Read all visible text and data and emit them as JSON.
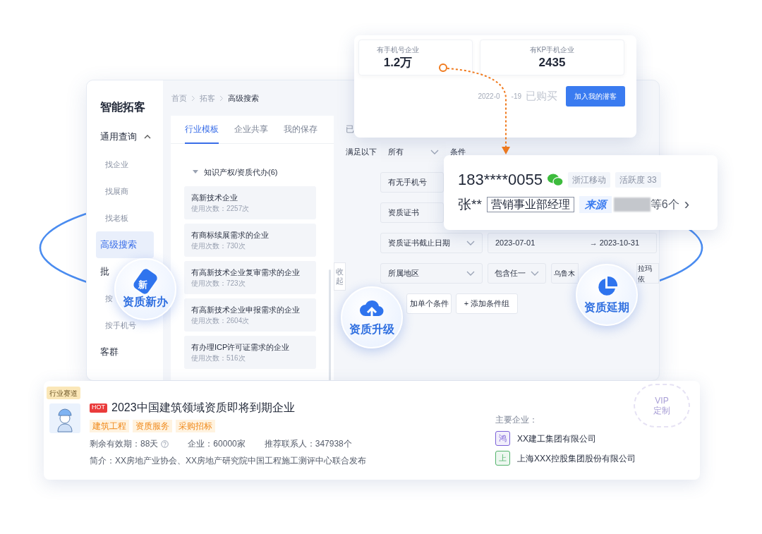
{
  "sidebar": {
    "title": "智能拓客",
    "items": [
      {
        "label": "通用查询",
        "kind": "group",
        "expanded": true
      },
      {
        "label": "找企业",
        "kind": "sub",
        "selected": false
      },
      {
        "label": "找展商",
        "kind": "sub",
        "selected": false
      },
      {
        "label": "找老板",
        "kind": "sub",
        "selected": false
      },
      {
        "label": "高级搜索",
        "kind": "main",
        "selected": true
      },
      {
        "label": "批",
        "kind": "main",
        "selected": false
      },
      {
        "label": "按",
        "kind": "sub",
        "selected": false
      },
      {
        "label": "按手机号",
        "kind": "sub",
        "selected": false
      },
      {
        "label": "客群",
        "kind": "main",
        "selected": false
      }
    ]
  },
  "breadcrumb": [
    "首页",
    "拓客",
    "高级搜索"
  ],
  "template_tabs": [
    {
      "label": "行业模板",
      "selected": true
    },
    {
      "label": "企业共享",
      "selected": false
    },
    {
      "label": "我的保存",
      "selected": false
    }
  ],
  "template_group": {
    "label": "知识产权/资质代办(6)",
    "expanded": true
  },
  "templates": [
    {
      "title": "高新技术企业",
      "usage": "使用次数：2257次"
    },
    {
      "title": "有商标续展需求的企业",
      "usage": "使用次数：730次"
    },
    {
      "title": "有高新技术企业复审需求的企业",
      "usage": "使用次数：723次"
    },
    {
      "title": "有高新技术企业申报需求的企业",
      "usage": "使用次数：2604次"
    },
    {
      "title": "有办理ICP许可证需求的企业",
      "usage": "使用次数：516次"
    }
  ],
  "collapse_label": "收起",
  "filters": {
    "cut_label": "已",
    "match_prefix": "满足以下",
    "match_value": "所有",
    "match_suffix": "条件",
    "rows": [
      {
        "field": "有无手机号",
        "kind": "short"
      },
      {
        "field": "资质证书",
        "kind": "short"
      },
      {
        "field": "资质证书截止日期",
        "kind": "date",
        "start": "2023-07-01",
        "end": "→ 2023-10-31"
      },
      {
        "field": "所属地区",
        "kind": "region",
        "operator": "包含任一",
        "values": [
          "乌鲁木",
          "拉玛依"
        ]
      }
    ],
    "add_buttons": [
      "加单个条件",
      "+ 添加条件组"
    ]
  },
  "stats_card": {
    "stats": [
      {
        "label": "有手机号企业",
        "value": "1.2万"
      },
      {
        "label": "有KP手机企业",
        "value": "2435"
      }
    ],
    "date_parts": [
      "2022-0",
      "-19"
    ],
    "purchased": "已购买",
    "button": "加入我的潜客"
  },
  "contact_card": {
    "phone": "183****0055",
    "tags": [
      "浙江移动",
      "活跃度 33"
    ],
    "name": "张**",
    "position": "营销事业部经理",
    "source_label": "来源",
    "source_more": "等6个",
    "chevron": "›"
  },
  "bubbles": [
    {
      "label": "资质新办",
      "kind": "tag",
      "tag_text": "新"
    },
    {
      "label": "资质升级",
      "kind": "cloud"
    },
    {
      "label": "资质延期",
      "kind": "pie"
    }
  ],
  "feature_card": {
    "ribbon": "行业赛道",
    "hot": "HOT",
    "title": "2023中国建筑领域资质即将到期企业",
    "tags": [
      "建筑工程",
      "资质服务",
      "采购招标"
    ],
    "stats": [
      {
        "text": "剩余有效期：88天",
        "help": true
      },
      {
        "text": "企业：60000家",
        "help": false
      },
      {
        "text": "推荐联系人：347938个",
        "help": false
      }
    ],
    "intro": "简介：XX房地产业协会、XX房地产研究院中国工程施工测评中心联合发布",
    "companies_label": "主要企业：",
    "companies": [
      {
        "badge": "鸿",
        "name": "XX建工集团有限公司",
        "color": "#7b61d9"
      },
      {
        "badge": "上",
        "name": "上海XXX控股集团股份有限公司",
        "color": "#52b36b"
      }
    ],
    "stamp": [
      "VIP",
      "定制"
    ]
  }
}
